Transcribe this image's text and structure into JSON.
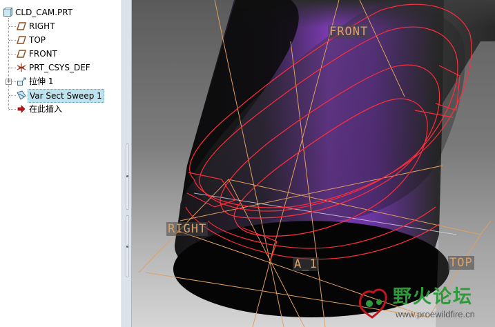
{
  "model_tree": {
    "root_label": "CLD_CAM.PRT",
    "items": [
      {
        "label": "RIGHT",
        "icon": "datum-plane-icon"
      },
      {
        "label": "TOP",
        "icon": "datum-plane-icon"
      },
      {
        "label": "FRONT",
        "icon": "datum-plane-icon"
      },
      {
        "label": "PRT_CSYS_DEF",
        "icon": "coordinate-system-icon"
      },
      {
        "label": "拉伸 1",
        "icon": "extrude-icon"
      },
      {
        "label": "Var Sect Sweep 1",
        "icon": "var-sect-sweep-icon",
        "selected": true
      },
      {
        "label": "在此插入",
        "icon": "insert-here-arrow-icon"
      }
    ]
  },
  "viewport": {
    "labels": {
      "front": "FRONT",
      "right": "RIGHT",
      "top": "TOP",
      "axis": "A_1"
    },
    "colors": {
      "datum_plane": "#e0a060",
      "edge_highlight": "#ff2d3c",
      "body_accent": "#7a3bb0"
    }
  },
  "watermark": {
    "text": "野火论坛",
    "url": "www.proewildfire.cn"
  }
}
